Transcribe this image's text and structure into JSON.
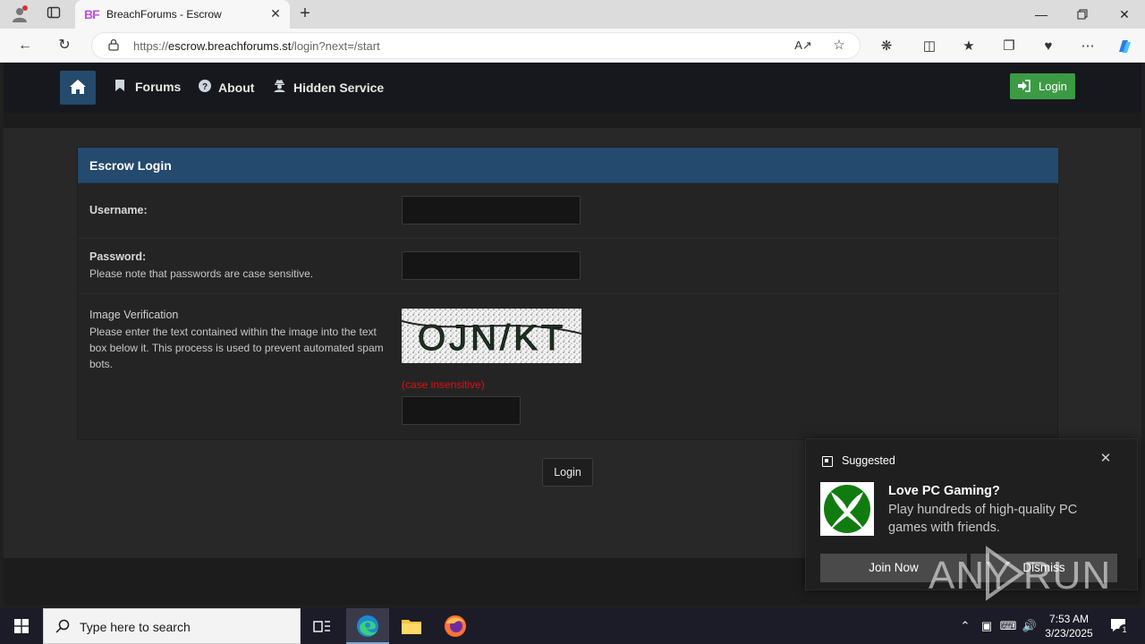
{
  "browser": {
    "tab_favicon": "BF",
    "tab_title": "BreachForums - Escrow",
    "url_scheme": "https://",
    "url_host": "escrow.breachforums.st",
    "url_path": "/login?next=/start"
  },
  "nav": {
    "forums": "Forums",
    "about": "About",
    "hidden_service": "Hidden Service",
    "login": "Login"
  },
  "form": {
    "title": "Escrow Login",
    "username_label": "Username:",
    "password_label": "Password:",
    "password_note": "Please note that passwords are case sensitive.",
    "captcha_label": "Image Verification",
    "captcha_desc": "Please enter the text contained within the image into the text box below it. This process is used to prevent automated spam bots.",
    "captcha_text": "OJN/KT",
    "case_note": "(case insensitive)",
    "submit": "Login"
  },
  "toast": {
    "header": "Suggested",
    "title": "Love PC Gaming?",
    "body": "Play hundreds of high-quality PC games with friends.",
    "primary": "Join Now",
    "secondary": "Dismiss"
  },
  "watermark": "ANY RUN",
  "taskbar": {
    "search_placeholder": "Type here to search",
    "time": "7:53 AM",
    "date": "3/23/2025",
    "notifications": "1"
  },
  "colors": {
    "header_blue": "#244a6d",
    "login_green": "#3c9a45",
    "warning_red": "#e01010"
  }
}
